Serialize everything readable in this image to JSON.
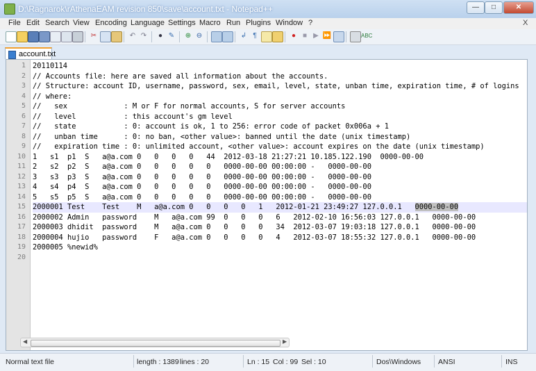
{
  "window": {
    "title": "D:\\Ragnarok\\rAthenaEAM revision 850\\save\\account.txt - Notepad++"
  },
  "menu": [
    "File",
    "Edit",
    "Search",
    "View",
    "Encoding",
    "Language",
    "Settings",
    "Macro",
    "Run",
    "Plugins",
    "Window",
    "?"
  ],
  "menu_close": "X",
  "tab": {
    "label": "account.txt"
  },
  "lines": [
    "20110114",
    "// Accounts file: here are saved all information about the accounts.",
    "// Structure: account ID, username, password, sex, email, level, state, unban time, expiration time, # of logins",
    "// where:",
    "//   sex             : M or F for normal accounts, S for server accounts",
    "//   level           : this account's gm level",
    "//   state           : 0: account is ok, 1 to 256: error code of packet 0x006a + 1",
    "//   unban time      : 0: no ban, <other value>: banned until the date (unix timestamp)",
    "//   expiration time : 0: unlimited account, <other value>: account expires on the date (unix timestamp)",
    "1   s1  p1  S   a@a.com 0   0   0   0   44  2012-03-18 21:27:21 10.185.122.190  0000-00-00",
    "2   s2  p2  S   a@a.com 0   0   0   0   0   0000-00-00 00:00:00 -   0000-00-00",
    "3   s3  p3  S   a@a.com 0   0   0   0   0   0000-00-00 00:00:00 -   0000-00-00",
    "4   s4  p4  S   a@a.com 0   0   0   0   0   0000-00-00 00:00:00 -   0000-00-00",
    "5   s5  p5  S   a@a.com 0   0   0   0   0   0000-00-00 00:00:00 -   0000-00-00",
    "2000001 Test    Test    M   a@a.com 0   0   0   0   1   2012-01-21 23:49:27 127.0.0.1   ",
    "2000002 Admin   password    M   a@a.com 99  0   0   0   6   2012-02-10 16:56:03 127.0.0.1   0000-00-00",
    "2000003 dhidit  password    M   a@a.com 0   0   0   0   34  2012-03-07 19:03:18 127.0.0.1   0000-00-00",
    "2000004 hujio   password    F   a@a.com 0   0   0   0   4   2012-03-07 18:55:32 127.0.0.1   0000-00-00",
    "2000005 %newid%",
    ""
  ],
  "line15_highlight": "0000-00-00",
  "status": {
    "type": "Normal text file",
    "length": "length : 1389",
    "lines": "lines : 20",
    "ln": "Ln : 15",
    "col": "Col : 99",
    "sel": "Sel : 10",
    "eol": "Dos\\Windows",
    "encoding": "ANSI",
    "mode": "INS"
  },
  "colors": {
    "current_line": "#e8e8ff",
    "selection": "#c0c0c0",
    "tab_accent": "#f0a030"
  }
}
